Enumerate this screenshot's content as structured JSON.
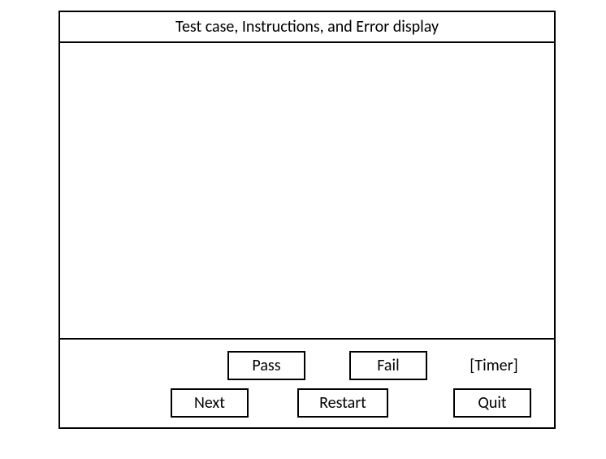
{
  "header": {
    "title": "Test case, Instructions, and Error display"
  },
  "footer": {
    "buttons": {
      "pass": "Pass",
      "fail": "Fail",
      "next": "Next",
      "restart": "Restart",
      "quit": "Quit"
    },
    "timer_label": "[Timer]"
  }
}
